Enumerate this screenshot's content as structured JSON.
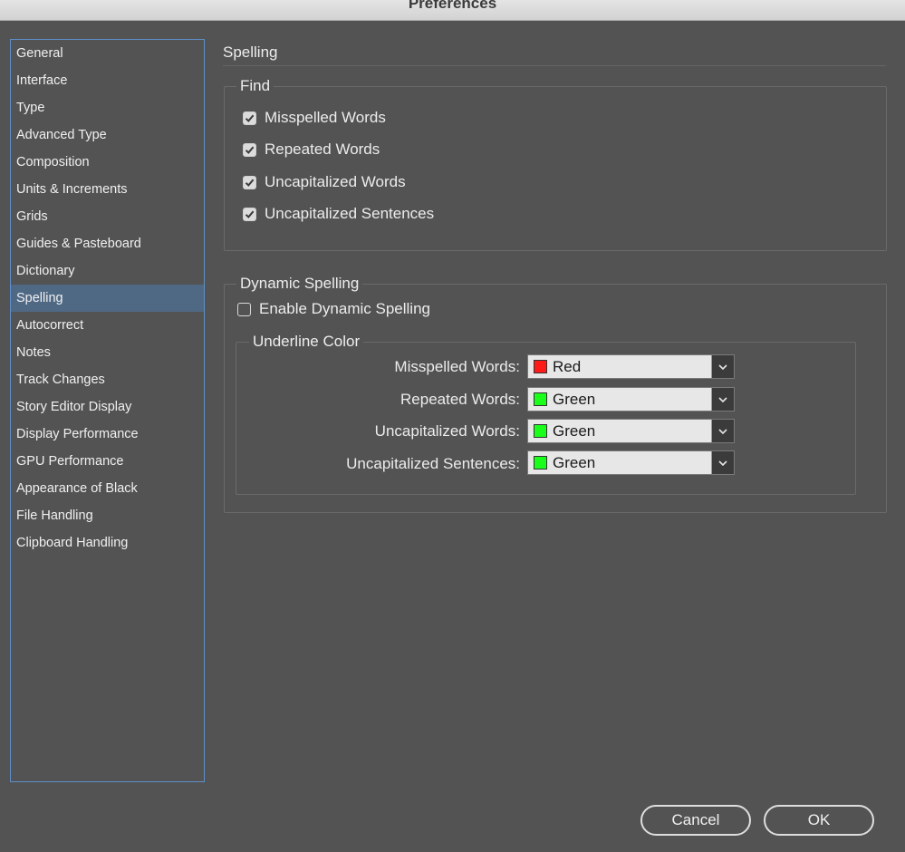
{
  "window": {
    "title": "Preferences"
  },
  "sidebar": {
    "selected_index": 9,
    "items": [
      {
        "label": "General"
      },
      {
        "label": "Interface"
      },
      {
        "label": "Type"
      },
      {
        "label": "Advanced Type"
      },
      {
        "label": "Composition"
      },
      {
        "label": "Units & Increments"
      },
      {
        "label": "Grids"
      },
      {
        "label": "Guides & Pasteboard"
      },
      {
        "label": "Dictionary"
      },
      {
        "label": "Spelling"
      },
      {
        "label": "Autocorrect"
      },
      {
        "label": "Notes"
      },
      {
        "label": "Track Changes"
      },
      {
        "label": "Story Editor Display"
      },
      {
        "label": "Display Performance"
      },
      {
        "label": "GPU Performance"
      },
      {
        "label": "Appearance of Black"
      },
      {
        "label": "File Handling"
      },
      {
        "label": "Clipboard Handling"
      }
    ]
  },
  "main": {
    "section_title": "Spelling",
    "find": {
      "legend": "Find",
      "options": [
        {
          "label": "Misspelled Words",
          "checked": true
        },
        {
          "label": "Repeated Words",
          "checked": true
        },
        {
          "label": "Uncapitalized Words",
          "checked": true
        },
        {
          "label": "Uncapitalized Sentences",
          "checked": true
        }
      ]
    },
    "dynamic": {
      "legend": "Dynamic Spelling",
      "enable": {
        "label": "Enable Dynamic Spelling",
        "checked": false
      },
      "underline": {
        "legend": "Underline Color",
        "rows": [
          {
            "label": "Misspelled Words:",
            "value": "Red",
            "swatch": "#ff1a1a"
          },
          {
            "label": "Repeated Words:",
            "value": "Green",
            "swatch": "#1aff1a"
          },
          {
            "label": "Uncapitalized Words:",
            "value": "Green",
            "swatch": "#1aff1a"
          },
          {
            "label": "Uncapitalized Sentences:",
            "value": "Green",
            "swatch": "#1aff1a"
          }
        ]
      }
    }
  },
  "footer": {
    "cancel_label": "Cancel",
    "ok_label": "OK"
  },
  "colors": {
    "background": "#535353",
    "selection": "#4f6985",
    "focus_border": "#5d8fc9"
  }
}
